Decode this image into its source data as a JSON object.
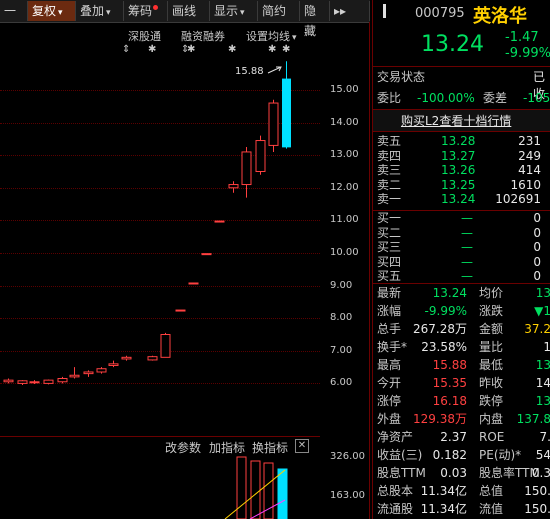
{
  "toolbar": {
    "items": [
      {
        "label": "一"
      },
      {
        "label": "复权",
        "caret": "▾",
        "active": true
      },
      {
        "label": "叠加",
        "caret": "▾"
      },
      {
        "label": "筹码",
        "dot": true
      },
      {
        "label": "画线"
      },
      {
        "label": "显示",
        "caret": "▾"
      },
      {
        "label": "简约"
      },
      {
        "label": "隐藏"
      },
      {
        "label": "▸▸"
      }
    ]
  },
  "chart": {
    "labels": {
      "shen_gu_tong": "深股通",
      "rong_zi_rong_quan": "融资融券",
      "ma_settings": "设置均线",
      "ma_settings_caret": "▾"
    },
    "markers": [
      "⇕",
      "✱",
      "⇕",
      "✱",
      "✱",
      "✱",
      "✱"
    ],
    "high_annotation": "15.88",
    "y_ticks": [
      "15.00",
      "14.00",
      "13.00",
      "12.00",
      "11.00",
      "10.00",
      "9.00",
      "8.00",
      "7.00",
      "6.00"
    ],
    "sub_buttons": {
      "modify": "改参数",
      "add": "加指标",
      "switch": "换指标",
      "close": "✕"
    },
    "sub_ticks": [
      "326.00",
      "163.00"
    ]
  },
  "chart_data": {
    "type": "candlestick",
    "y_range": [
      5.5,
      15.9
    ],
    "candles": [
      {
        "o": 6.05,
        "h": 6.15,
        "l": 6.0,
        "c": 6.1
      },
      {
        "o": 6.0,
        "h": 6.1,
        "l": 5.95,
        "c": 6.08
      },
      {
        "o": 6.02,
        "h": 6.1,
        "l": 5.98,
        "c": 6.05
      },
      {
        "o": 6.0,
        "h": 6.12,
        "l": 5.97,
        "c": 6.1
      },
      {
        "o": 6.05,
        "h": 6.2,
        "l": 6.0,
        "c": 6.15
      },
      {
        "o": 6.2,
        "h": 6.5,
        "l": 6.15,
        "c": 6.25
      },
      {
        "o": 6.3,
        "h": 6.4,
        "l": 6.2,
        "c": 6.35
      },
      {
        "o": 6.35,
        "h": 6.5,
        "l": 6.3,
        "c": 6.45
      },
      {
        "o": 6.55,
        "h": 6.7,
        "l": 6.5,
        "c": 6.6
      },
      {
        "o": 6.75,
        "h": 6.85,
        "l": 6.7,
        "c": 6.8
      },
      {
        "o": 6.72,
        "h": 6.85,
        "l": 6.7,
        "c": 6.82
      },
      {
        "o": 6.8,
        "h": 7.55,
        "l": 6.8,
        "c": 7.5
      },
      {
        "o": 8.25,
        "h": 8.25,
        "l": 8.25,
        "c": 8.25
      },
      {
        "o": 9.08,
        "h": 9.08,
        "l": 9.08,
        "c": 9.08
      },
      {
        "o": 9.98,
        "h": 9.98,
        "l": 9.98,
        "c": 9.98
      },
      {
        "o": 10.98,
        "h": 10.98,
        "l": 10.98,
        "c": 10.98
      },
      {
        "o": 12.0,
        "h": 12.2,
        "l": 11.85,
        "c": 12.1
      },
      {
        "o": 12.1,
        "h": 13.25,
        "l": 11.7,
        "c": 13.1
      },
      {
        "o": 12.5,
        "h": 13.6,
        "l": 12.4,
        "c": 13.45
      },
      {
        "o": 13.3,
        "h": 14.7,
        "l": 13.1,
        "c": 14.6
      },
      {
        "o": 15.35,
        "h": 15.88,
        "l": 13.2,
        "c": 13.24
      }
    ]
  },
  "quote": {
    "code": "000795",
    "name": "英洛华",
    "price": "13.24",
    "change": "-1.47",
    "change_pct": "-9.99%"
  },
  "status": {
    "label": "交易状态",
    "value": "已收"
  },
  "ratio": {
    "wb_label": "委比",
    "wb_value": "-100.00%",
    "wc_label": "委差",
    "wc_value": "-105"
  },
  "l2_link": "购买L2查看十档行情",
  "asks": [
    {
      "label": "卖五",
      "price": "13.28",
      "vol": "231"
    },
    {
      "label": "卖四",
      "price": "13.27",
      "vol": "249"
    },
    {
      "label": "卖三",
      "price": "13.26",
      "vol": "414"
    },
    {
      "label": "卖二",
      "price": "13.25",
      "vol": "1610"
    },
    {
      "label": "卖一",
      "price": "13.24",
      "vol": "102691"
    }
  ],
  "bids": [
    {
      "label": "买一",
      "price": "—",
      "vol": "0"
    },
    {
      "label": "买二",
      "price": "—",
      "vol": "0"
    },
    {
      "label": "买三",
      "price": "—",
      "vol": "0"
    },
    {
      "label": "买四",
      "price": "—",
      "vol": "0"
    },
    {
      "label": "买五",
      "price": "—",
      "vol": "0"
    }
  ],
  "stats": [
    {
      "l1": "最新",
      "v1": "13.24",
      "c1": "green",
      "l2": "均价",
      "v2": "13",
      "c2": "green"
    },
    {
      "l1": "涨幅",
      "v1": "-9.99%",
      "c1": "green",
      "l2": "涨跌",
      "v2": "▼1",
      "c2": "green"
    },
    {
      "l1": "总手",
      "v1": "267.28万",
      "c1": "white",
      "l2": "金额",
      "v2": "37.2",
      "c2": "yellow"
    },
    {
      "l1": "换手*",
      "v1": "23.58%",
      "c1": "white",
      "l2": "量比",
      "v2": "1",
      "c2": "white"
    },
    {
      "l1": "最高",
      "v1": "15.88",
      "c1": "red",
      "l2": "最低",
      "v2": "13",
      "c2": "green"
    },
    {
      "l1": "今开",
      "v1": "15.35",
      "c1": "red",
      "l2": "昨收",
      "v2": "14",
      "c2": "white"
    },
    {
      "l1": "涨停",
      "v1": "16.18",
      "c1": "red",
      "l2": "跌停",
      "v2": "13",
      "c2": "green"
    },
    {
      "l1": "外盘",
      "v1": "129.38万",
      "c1": "red",
      "l2": "内盘",
      "v2": "137.8",
      "c2": "green"
    },
    {
      "l1": "净资产",
      "v1": "2.37",
      "c1": "white",
      "l2": "ROE",
      "v2": "7.",
      "c2": "white"
    },
    {
      "l1": "收益(三)",
      "v1": "0.182",
      "c1": "white",
      "l2": "PE(动)*",
      "v2": "54",
      "c2": "white"
    },
    {
      "l1": "股息TTM",
      "v1": "0.03",
      "c1": "white",
      "l2": "股息率TTM",
      "v2": "0.3",
      "c2": "white"
    },
    {
      "l1": "总股本",
      "v1": "11.34亿",
      "c1": "white",
      "l2": "总值",
      "v2": "150.",
      "c2": "white"
    },
    {
      "l1": "流通股",
      "v1": "11.34亿",
      "c1": "white",
      "l2": "流值",
      "v2": "150.",
      "c2": "white"
    }
  ]
}
